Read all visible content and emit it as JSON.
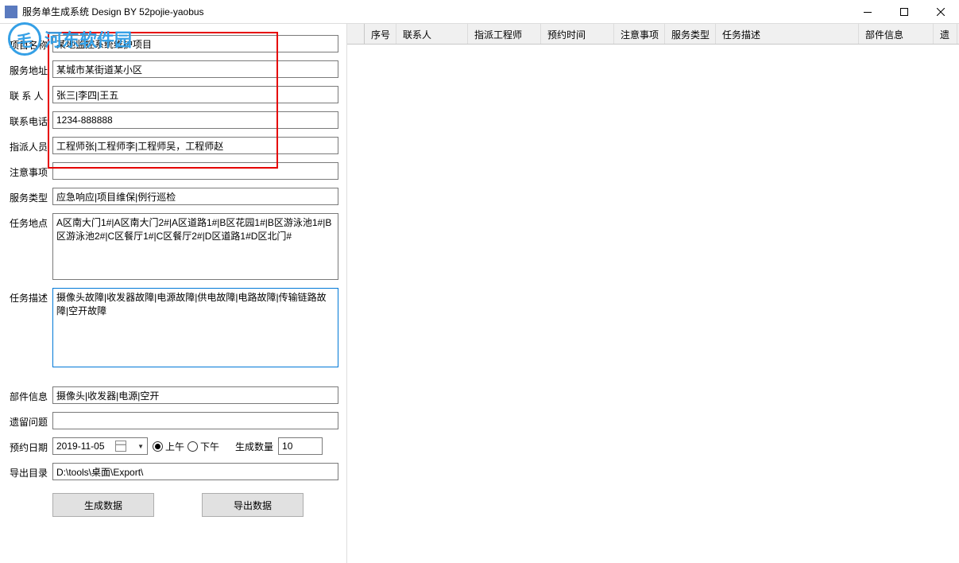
{
  "window": {
    "title": "服务单生成系统  Design BY 52pojie-yaobus"
  },
  "watermark": {
    "logo": "毛",
    "text": "河东软件园"
  },
  "form": {
    "project_name": {
      "label": "项目名称",
      "value": "某地监控系统维护项目"
    },
    "service_addr": {
      "label": "服务地址",
      "value": "某城市某街道某小区"
    },
    "contact": {
      "label": "联 系 人",
      "value": "张三|李四|王五"
    },
    "phone": {
      "label": "联系电话",
      "value": "1234-888888"
    },
    "assigned": {
      "label": "指派人员",
      "value": "工程师张|工程师李|工程师吴，工程师赵"
    },
    "notes": {
      "label": "注意事项",
      "value": ""
    },
    "service_type": {
      "label": "服务类型",
      "value": "应急响应|项目维保|例行巡检"
    },
    "task_loc": {
      "label": "任务地点",
      "value": "A区南大门1#|A区南大门2#|A区道路1#|B区花园1#|B区游泳池1#|B区游泳池2#|C区餐厅1#|C区餐厅2#|D区道路1#D区北门#"
    },
    "task_desc": {
      "label": "任务描述",
      "value": "摄像头故障|收发器故障|电源故障|供电故障|电路故障|传输链路故障|空开故障"
    },
    "parts": {
      "label": "部件信息",
      "value": "摄像头|收发器|电源|空开"
    },
    "pending": {
      "label": "遗留问题",
      "value": ""
    },
    "appt_date": {
      "label": "预约日期",
      "value": "2019-11-05"
    },
    "am": {
      "label": "上午"
    },
    "pm": {
      "label": "下午"
    },
    "gen_qty": {
      "label": "生成数量",
      "value": "10"
    },
    "export_dir": {
      "label": "导出目录",
      "value": "D:\\tools\\桌面\\Export\\"
    }
  },
  "buttons": {
    "generate": "生成数据",
    "export": "导出数据"
  },
  "grid": {
    "columns": [
      "序号",
      "联系人",
      "指派工程师",
      "预约时间",
      "注意事项",
      "服务类型",
      "任务描述",
      "部件信息",
      "遗"
    ]
  }
}
